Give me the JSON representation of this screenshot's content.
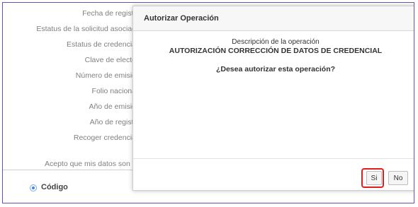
{
  "form": {
    "labels": [
      "Fecha de registr",
      "Estatus de la solicitud asociad",
      "Estatus de credencia",
      "Clave de electo",
      "Número de emisió",
      "Folio naciona",
      "Año de emisió",
      "Año de registr",
      "Recoger credencia",
      "Acepto que mis datos son c"
    ],
    "radio_label": "Código"
  },
  "modal": {
    "title": "Autorizar Operación",
    "description_label": "Descripción de la operación",
    "operation_name": "AUTORIZACIÓN CORRECCIÓN DE DATOS DE CREDENCIAL",
    "question": "¿Desea autorizar esta operación?",
    "buttons": {
      "yes": "Si",
      "no": "No"
    }
  },
  "colors": {
    "frame_border": "#6b4fb0",
    "highlight": "#e41b1b",
    "radio_accent": "#3f86e0"
  }
}
